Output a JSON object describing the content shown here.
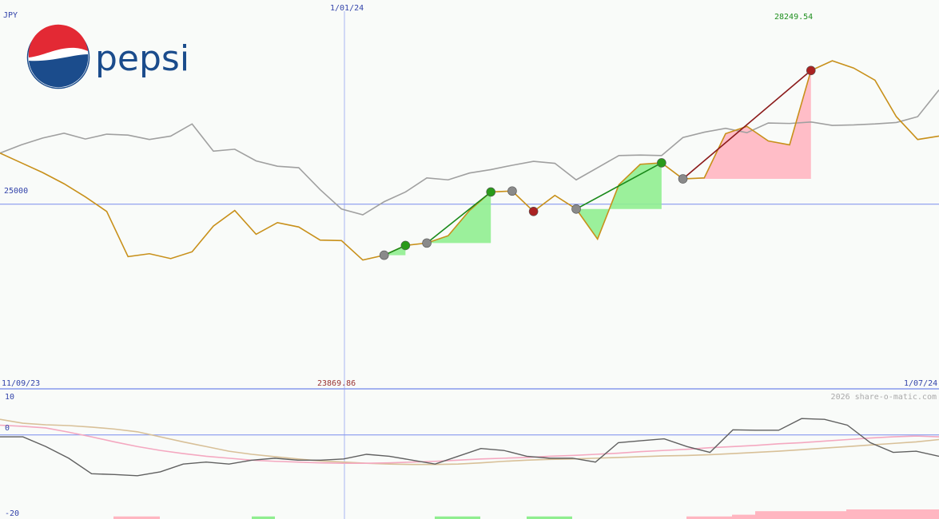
{
  "chart_data": {
    "type": "line",
    "currency": "JPY",
    "x_labels": {
      "start": "11/09/23",
      "mid": "1/01/24",
      "end": "1/07/24"
    },
    "main": {
      "ylim": [
        21200,
        29200
      ],
      "ref_line": 25000,
      "ref_label": "25000",
      "high_label": "28249.54",
      "low_label": "23869.86",
      "price": [
        26050,
        25850,
        25650,
        25420,
        25150,
        24850,
        23920,
        23980,
        23880,
        24020,
        24550,
        24870,
        24380,
        24620,
        24530,
        24260,
        24250,
        23850,
        23950,
        24150,
        24200,
        24350,
        24870,
        25250,
        25270,
        24850,
        25180,
        24900,
        24280,
        25400,
        25820,
        25850,
        25520,
        25540,
        26450,
        26600,
        26300,
        26220,
        27750,
        27950,
        27800,
        27550,
        26800,
        26330,
        26400
      ],
      "compare": [
        26050,
        26220,
        26360,
        26460,
        26340,
        26440,
        26420,
        26330,
        26400,
        26650,
        26090,
        26130,
        25890,
        25780,
        25750,
        25300,
        24900,
        24780,
        25050,
        25250,
        25540,
        25500,
        25640,
        25710,
        25800,
        25880,
        25840,
        25500,
        25750,
        26000,
        26010,
        26000,
        26370,
        26480,
        26560,
        26470,
        26670,
        26660,
        26690,
        26620,
        26630,
        26650,
        26680,
        26800,
        27350
      ],
      "signals": [
        {
          "i": 18,
          "color": "grey"
        },
        {
          "i": 19,
          "color": "green"
        },
        {
          "i": 20,
          "color": "grey"
        },
        {
          "i": 23,
          "color": "green"
        },
        {
          "i": 24,
          "color": "grey"
        },
        {
          "i": 25,
          "color": "red"
        },
        {
          "i": 27,
          "color": "grey"
        },
        {
          "i": 31,
          "color": "green"
        },
        {
          "i": 32,
          "color": "grey"
        },
        {
          "i": 38,
          "color": "red"
        }
      ],
      "trend_lines": [
        {
          "from": 18,
          "to": 19,
          "color": "green"
        },
        {
          "from": 20,
          "to": 23,
          "color": "green"
        },
        {
          "from": 27,
          "to": 31,
          "color": "green"
        },
        {
          "from": 32,
          "to": 38,
          "color": "red"
        }
      ]
    },
    "oscillator": {
      "ylim": [
        -20,
        10
      ],
      "tick_labels": [
        "10",
        "0",
        "-20"
      ],
      "line": [
        -0.5,
        -0.5,
        -3,
        -6,
        -10,
        -10.2,
        -10.5,
        -9.5,
        -7.5,
        -7,
        -7.5,
        -6.5,
        -6,
        -6.5,
        -6.5,
        -6.2,
        -5,
        -5.5,
        -6.5,
        -7.5,
        -5.5,
        -3.5,
        -4,
        -5.5,
        -6,
        -6,
        -7,
        -2,
        -1.5,
        -1,
        -3,
        -4.5,
        1.3,
        1.2,
        1.2,
        4.2,
        4,
        2.5,
        -2,
        -4.5,
        -4.2,
        -5.5
      ],
      "signal_pink": [
        2.5,
        2.2,
        1.8,
        0.7,
        -0.5,
        -1.8,
        -3,
        -4,
        -4.8,
        -5.5,
        -6,
        -6.5,
        -6.8,
        -7,
        -7.2,
        -7.3,
        -7.3,
        -7.2,
        -7,
        -6.8,
        -6.5,
        -6.2,
        -6,
        -5.8,
        -5.5,
        -5.3,
        -5,
        -4.7,
        -4.3,
        -4,
        -3.7,
        -3.3,
        -3,
        -2.7,
        -2.3,
        -2,
        -1.6,
        -1.2,
        -0.8,
        -0.5,
        -0.3,
        -0.5
      ],
      "signal_tan": [
        4,
        3,
        2.6,
        2.4,
        2,
        1.5,
        0.8,
        -0.5,
        -1.8,
        -3,
        -4.2,
        -5,
        -5.6,
        -6.2,
        -6.7,
        -7,
        -7.3,
        -7.5,
        -7.6,
        -7.6,
        -7.5,
        -7.2,
        -6.8,
        -6.5,
        -6.3,
        -6.2,
        -6,
        -5.8,
        -5.6,
        -5.4,
        -5.3,
        -5.1,
        -4.8,
        -4.5,
        -4.2,
        -3.8,
        -3.4,
        -3,
        -2.6,
        -2.2,
        -1.8,
        -1.2
      ]
    },
    "volume_bars": [
      {
        "from": 142,
        "to": 200,
        "color": "pink",
        "level": 0.2
      },
      {
        "from": 315,
        "to": 344,
        "color": "green",
        "level": 0.2
      },
      {
        "from": 544,
        "to": 601,
        "color": "green",
        "level": 0.2
      },
      {
        "from": 659,
        "to": 716,
        "color": "green",
        "level": 0.2
      },
      {
        "from": 859,
        "to": 916,
        "color": "pink",
        "level": 0.2
      },
      {
        "from": 916,
        "to": 945,
        "color": "pink",
        "level": 0.4
      },
      {
        "from": 945,
        "to": 1059,
        "color": "pink",
        "level": 0.8
      },
      {
        "from": 1059,
        "to": 1175,
        "color": "pink",
        "level": 1.0
      }
    ]
  },
  "watermark": "2026 share-o-matic.com",
  "logo": {
    "word": "pepsi",
    "colors": {
      "red": "#e32934",
      "blue": "#1b4c8c",
      "white": "#ffffff"
    }
  },
  "colors": {
    "price": "#c8901a",
    "compare": "#a0a0a0",
    "axis": "#8899ee",
    "label_blue": "#3344aa",
    "label_green": "#1f8f1f",
    "label_red": "#993333",
    "fill_green": "#90ee90",
    "fill_pink": "#ffb6c1",
    "osc_line": "#606060",
    "osc_pink": "#f4a8c0",
    "osc_tan": "#d8c098",
    "dot_grey": "#8a8a8a",
    "dot_green": "#2a9a1a",
    "dot_red": "#aa2222",
    "trend_green": "#1a8a1a",
    "trend_red": "#8b1a1a"
  }
}
